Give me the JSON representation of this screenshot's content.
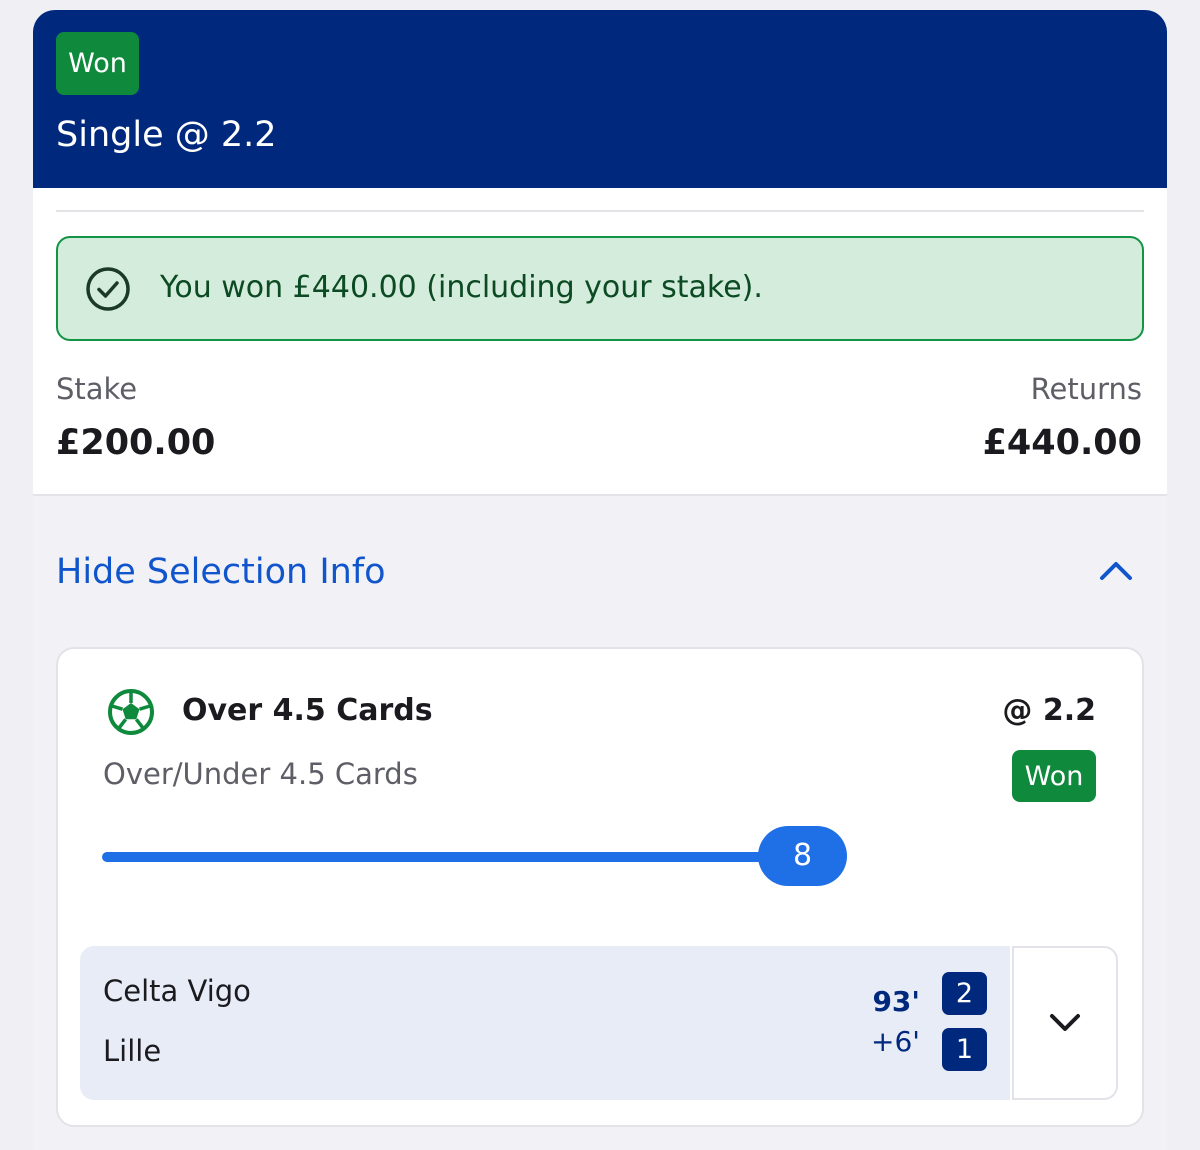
{
  "bet": {
    "status": "Won",
    "title": "Single @ 2.2",
    "result_message": "You won £440.00 (including your stake).",
    "stake_label": "Stake",
    "stake_value": "£200.00",
    "returns_label": "Returns",
    "returns_value": "£440.00"
  },
  "selection_toggle": {
    "label": "Hide Selection Info",
    "icon": "chevron-up-icon"
  },
  "selection": {
    "sport_icon": "football-icon",
    "name": "Over 4.5 Cards",
    "odds": "@ 2.2",
    "market": "Over/Under 4.5 Cards",
    "status": "Won",
    "progress_value": "8",
    "progress_fraction": 1.0
  },
  "match": {
    "home_team": "Celta Vigo",
    "away_team": "Lille",
    "clock_main": "93'",
    "clock_added": "+6'",
    "home_score": "2",
    "away_score": "1",
    "expand_icon": "chevron-down-icon"
  },
  "colors": {
    "header_bg": "#00287d",
    "won_green": "#0f8a3c",
    "banner_bg": "#d4ecdb",
    "link_blue": "#1155cc",
    "progress_blue": "#1f6fe6"
  }
}
